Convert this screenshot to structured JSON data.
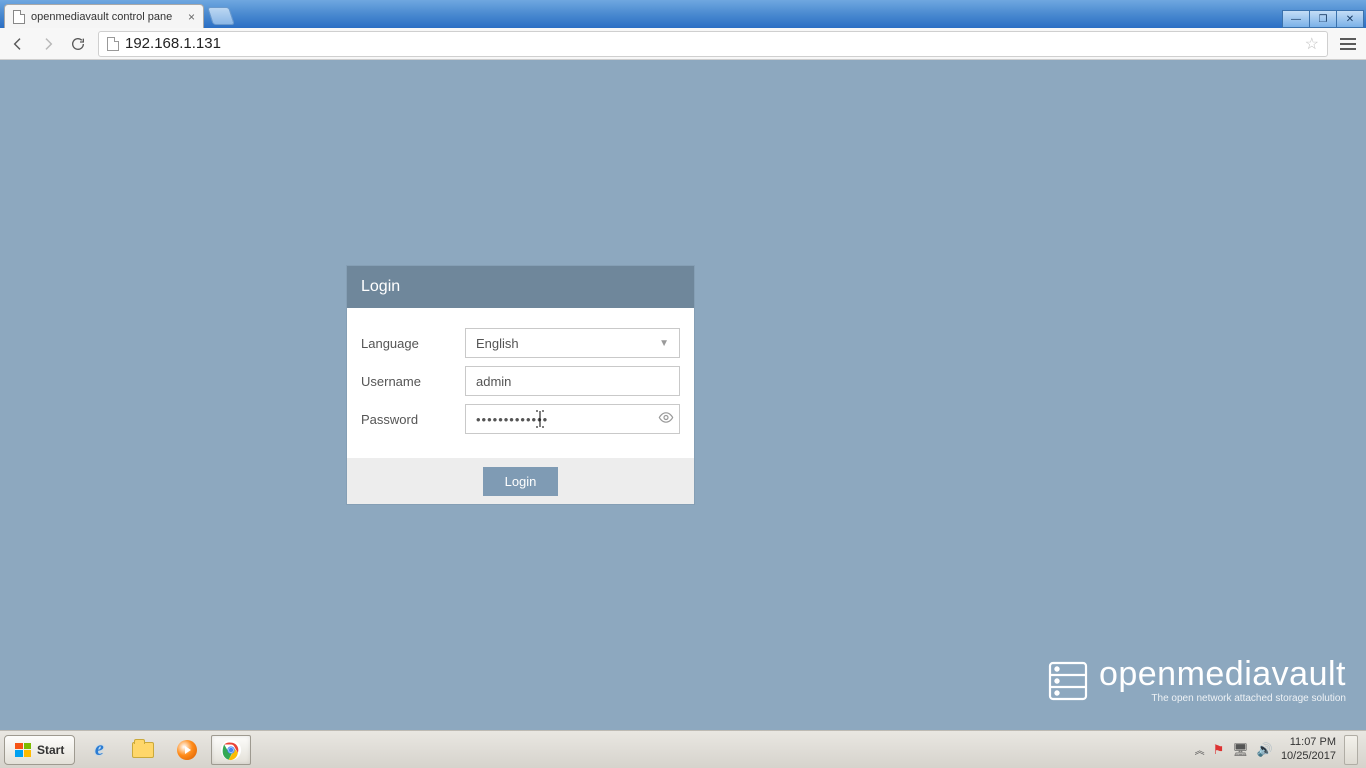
{
  "browser": {
    "tab_title": "openmediavault control pane",
    "url": "192.168.1.131"
  },
  "login": {
    "header": "Login",
    "language_label": "Language",
    "language_value": "English",
    "username_label": "Username",
    "username_value": "admin",
    "password_label": "Password",
    "password_value": "•••••••••••••",
    "button": "Login"
  },
  "brand": {
    "name": "openmediavault",
    "tagline": "The open network attached storage solution"
  },
  "taskbar": {
    "start": "Start",
    "time": "11:07 PM",
    "date": "10/25/2017"
  }
}
